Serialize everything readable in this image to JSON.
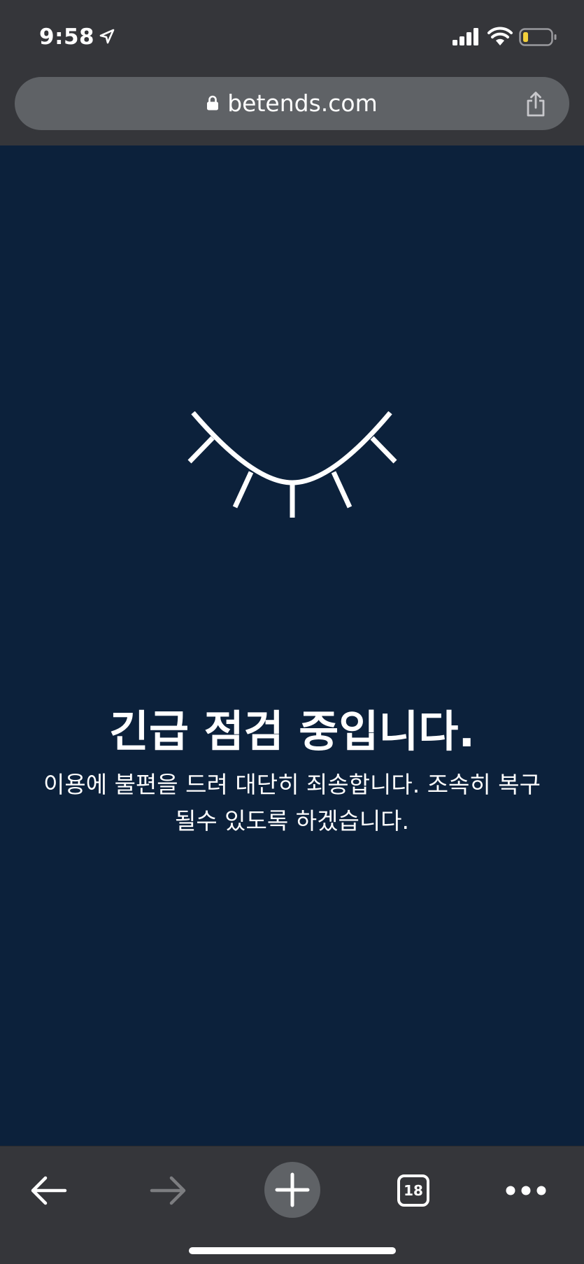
{
  "status_bar": {
    "time": "9:58",
    "icons": [
      "location-arrow-icon",
      "cellular-signal-icon",
      "wifi-icon",
      "battery-icon"
    ],
    "battery_color": "#f2d03b"
  },
  "browser": {
    "url": "betends.com",
    "lock_icon": "lock-icon",
    "share_icon": "share-icon"
  },
  "page": {
    "background_color": "#0c213b",
    "illustration": "closed-eye-icon",
    "title": "긴급 점검 중입니다.",
    "message_line1": "이용에 불편을 드려 대단히 죄송합니다. 조속히 복구",
    "message_line2": "될수 있도록 하겠습니다."
  },
  "toolbar": {
    "back_icon": "arrow-left-icon",
    "forward_icon": "arrow-right-icon",
    "new_tab_icon": "plus-icon",
    "tab_count": "18",
    "more_icon": "ellipsis-icon"
  }
}
